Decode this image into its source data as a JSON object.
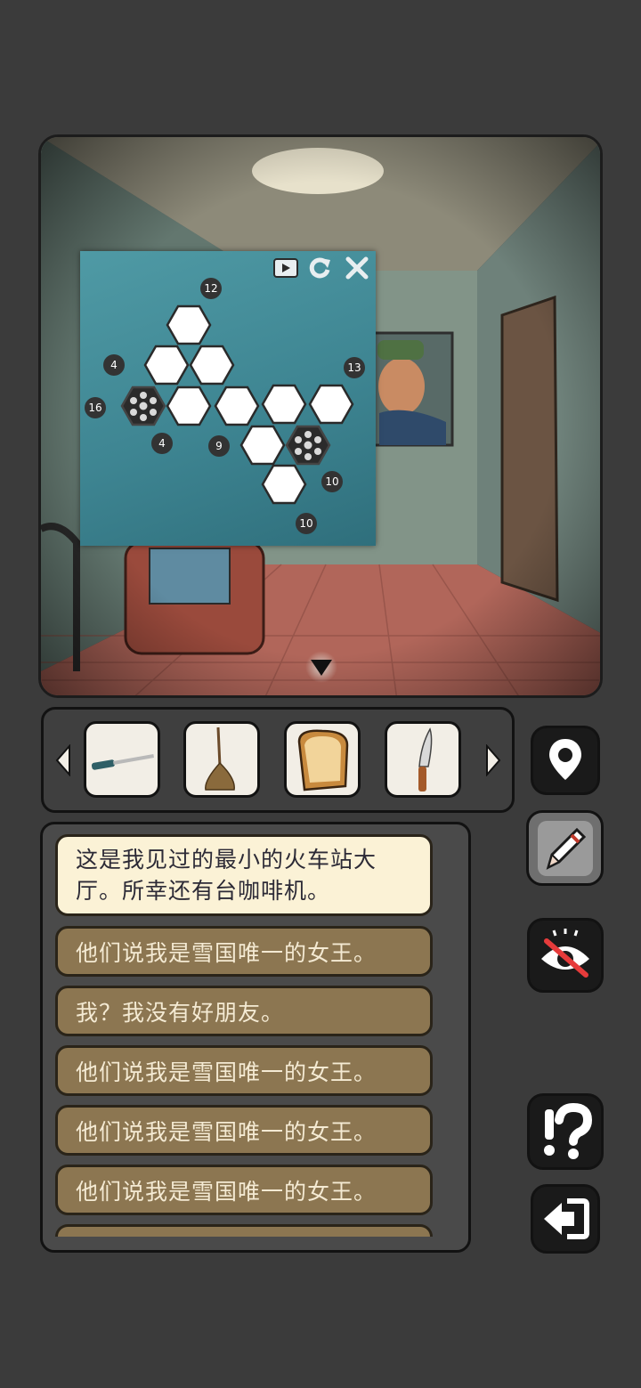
{
  "puzzle": {
    "tools": {
      "video_icon": "video-icon",
      "reset_icon": "reset-icon",
      "close_icon": "close-icon"
    },
    "clues": [
      "12",
      "4",
      "13",
      "16",
      "4",
      "9",
      "10",
      "10"
    ]
  },
  "inventory": {
    "items": [
      "screwdriver-icon",
      "broom-icon",
      "bread-icon",
      "knife-icon"
    ]
  },
  "dialogue": {
    "active": "这是我见过的最小的火车站大厅。所幸还有台咖啡机。",
    "options": [
      "他们说我是雪国唯一的女王。",
      "我？我没有好朋友。",
      "他们说我是雪国唯一的女王。",
      "他们说我是雪国唯一的女王。",
      "他们说我是雪国唯一的女王。"
    ]
  },
  "colors": {
    "hex_fill": "#ffffff",
    "hex_dark": "#2a2a2a",
    "clue_bubble": "#333333",
    "dialogue_option": "#8c7651",
    "dialogue_active": "#fbf2d6"
  }
}
